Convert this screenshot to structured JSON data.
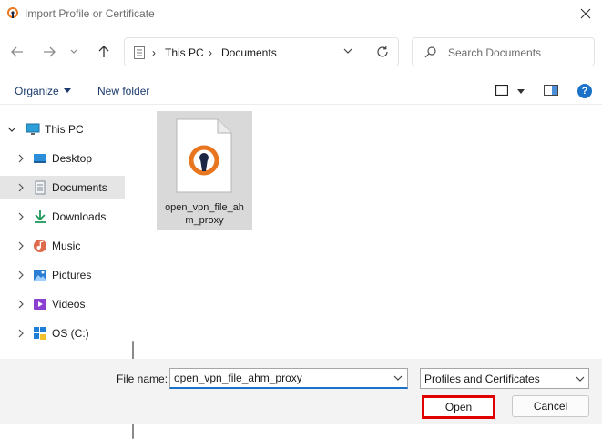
{
  "window": {
    "title": "Import Profile or Certificate"
  },
  "address_bar": {
    "crumbs": [
      "This PC",
      "Documents"
    ]
  },
  "search": {
    "placeholder": "Search Documents"
  },
  "toolbar": {
    "organize_label": "Organize",
    "new_folder_label": "New folder",
    "help_label": "?"
  },
  "sidebar": {
    "items": [
      {
        "label": "This PC",
        "icon": "monitor-icon",
        "expanded": true
      },
      {
        "label": "Desktop",
        "icon": "desktop-icon"
      },
      {
        "label": "Documents",
        "icon": "documents-icon",
        "selected": true
      },
      {
        "label": "Downloads",
        "icon": "download-icon"
      },
      {
        "label": "Music",
        "icon": "music-icon"
      },
      {
        "label": "Pictures",
        "icon": "pictures-icon"
      },
      {
        "label": "Videos",
        "icon": "videos-icon"
      },
      {
        "label": "OS (C:)",
        "icon": "drive-icon"
      }
    ]
  },
  "files": [
    {
      "name": "open_vpn_file_ahm_proxy",
      "icon": "openvpn-file-icon"
    }
  ],
  "footer": {
    "file_name_label": "File name:",
    "file_name_value": "open_vpn_file_ahm_proxy",
    "file_type_selected": "Profiles and Certificates",
    "open_label": "Open",
    "cancel_label": "Cancel"
  },
  "colors": {
    "accent": "#1a73c8",
    "highlight_border": "#e00000",
    "openvpn_orange": "#e8761e",
    "openvpn_navy": "#1b2744"
  }
}
